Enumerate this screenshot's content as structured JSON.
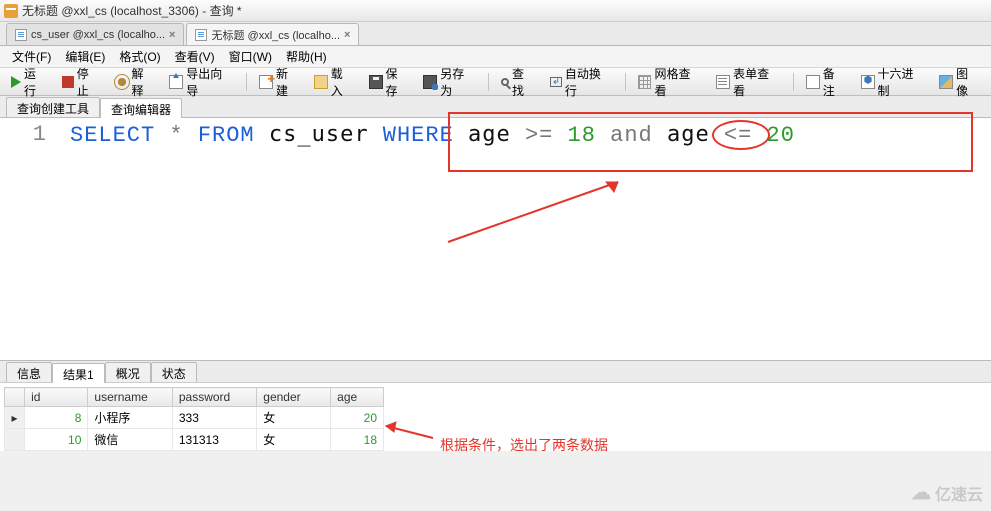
{
  "window": {
    "title": "无标题 @xxl_cs (localhost_3306) - 查询 *"
  },
  "file_tabs": [
    {
      "label": "cs_user @xxl_cs (localho...",
      "active": false
    },
    {
      "label": "无标题 @xxl_cs (localho...",
      "active": true
    }
  ],
  "menu": {
    "file": "文件(F)",
    "edit": "编辑(E)",
    "format": "格式(O)",
    "view": "查看(V)",
    "window": "窗口(W)",
    "help": "帮助(H)"
  },
  "toolbar": {
    "run": "运行",
    "stop": "停止",
    "explain": "解释",
    "export": "导出向导",
    "new": "新建",
    "load": "载入",
    "save": "保存",
    "saveas": "另存为",
    "find": "查找",
    "wrap": "自动换行",
    "gridview": "网格查看",
    "formview": "表单查看",
    "note": "备注",
    "hex": "十六进制",
    "image": "图像"
  },
  "editor_tabs": {
    "builder": "查询创建工具",
    "editor": "查询编辑器"
  },
  "sql": {
    "line_no": "1",
    "tokens": {
      "select": "SELECT",
      "star": "*",
      "from": "FROM",
      "table": "cs_user",
      "where": "WHERE",
      "col1": "age",
      "op1": ">=",
      "val1": "18",
      "and": "and",
      "col2": "age",
      "op2": "<=",
      "val2": "20"
    }
  },
  "annotation": {
    "text": "根据条件，选出了两条数据"
  },
  "result_tabs": {
    "info": "信息",
    "result": "结果1",
    "profile": "概况",
    "status": "状态"
  },
  "grid": {
    "headers": {
      "id": "id",
      "username": "username",
      "password": "password",
      "gender": "gender",
      "age": "age"
    },
    "rows": [
      {
        "id": "8",
        "username": "小程序",
        "password": "333",
        "gender": "女",
        "age": "20"
      },
      {
        "id": "10",
        "username": "微信",
        "password": "131313",
        "gender": "女",
        "age": "18"
      }
    ]
  },
  "watermark": "亿速云"
}
